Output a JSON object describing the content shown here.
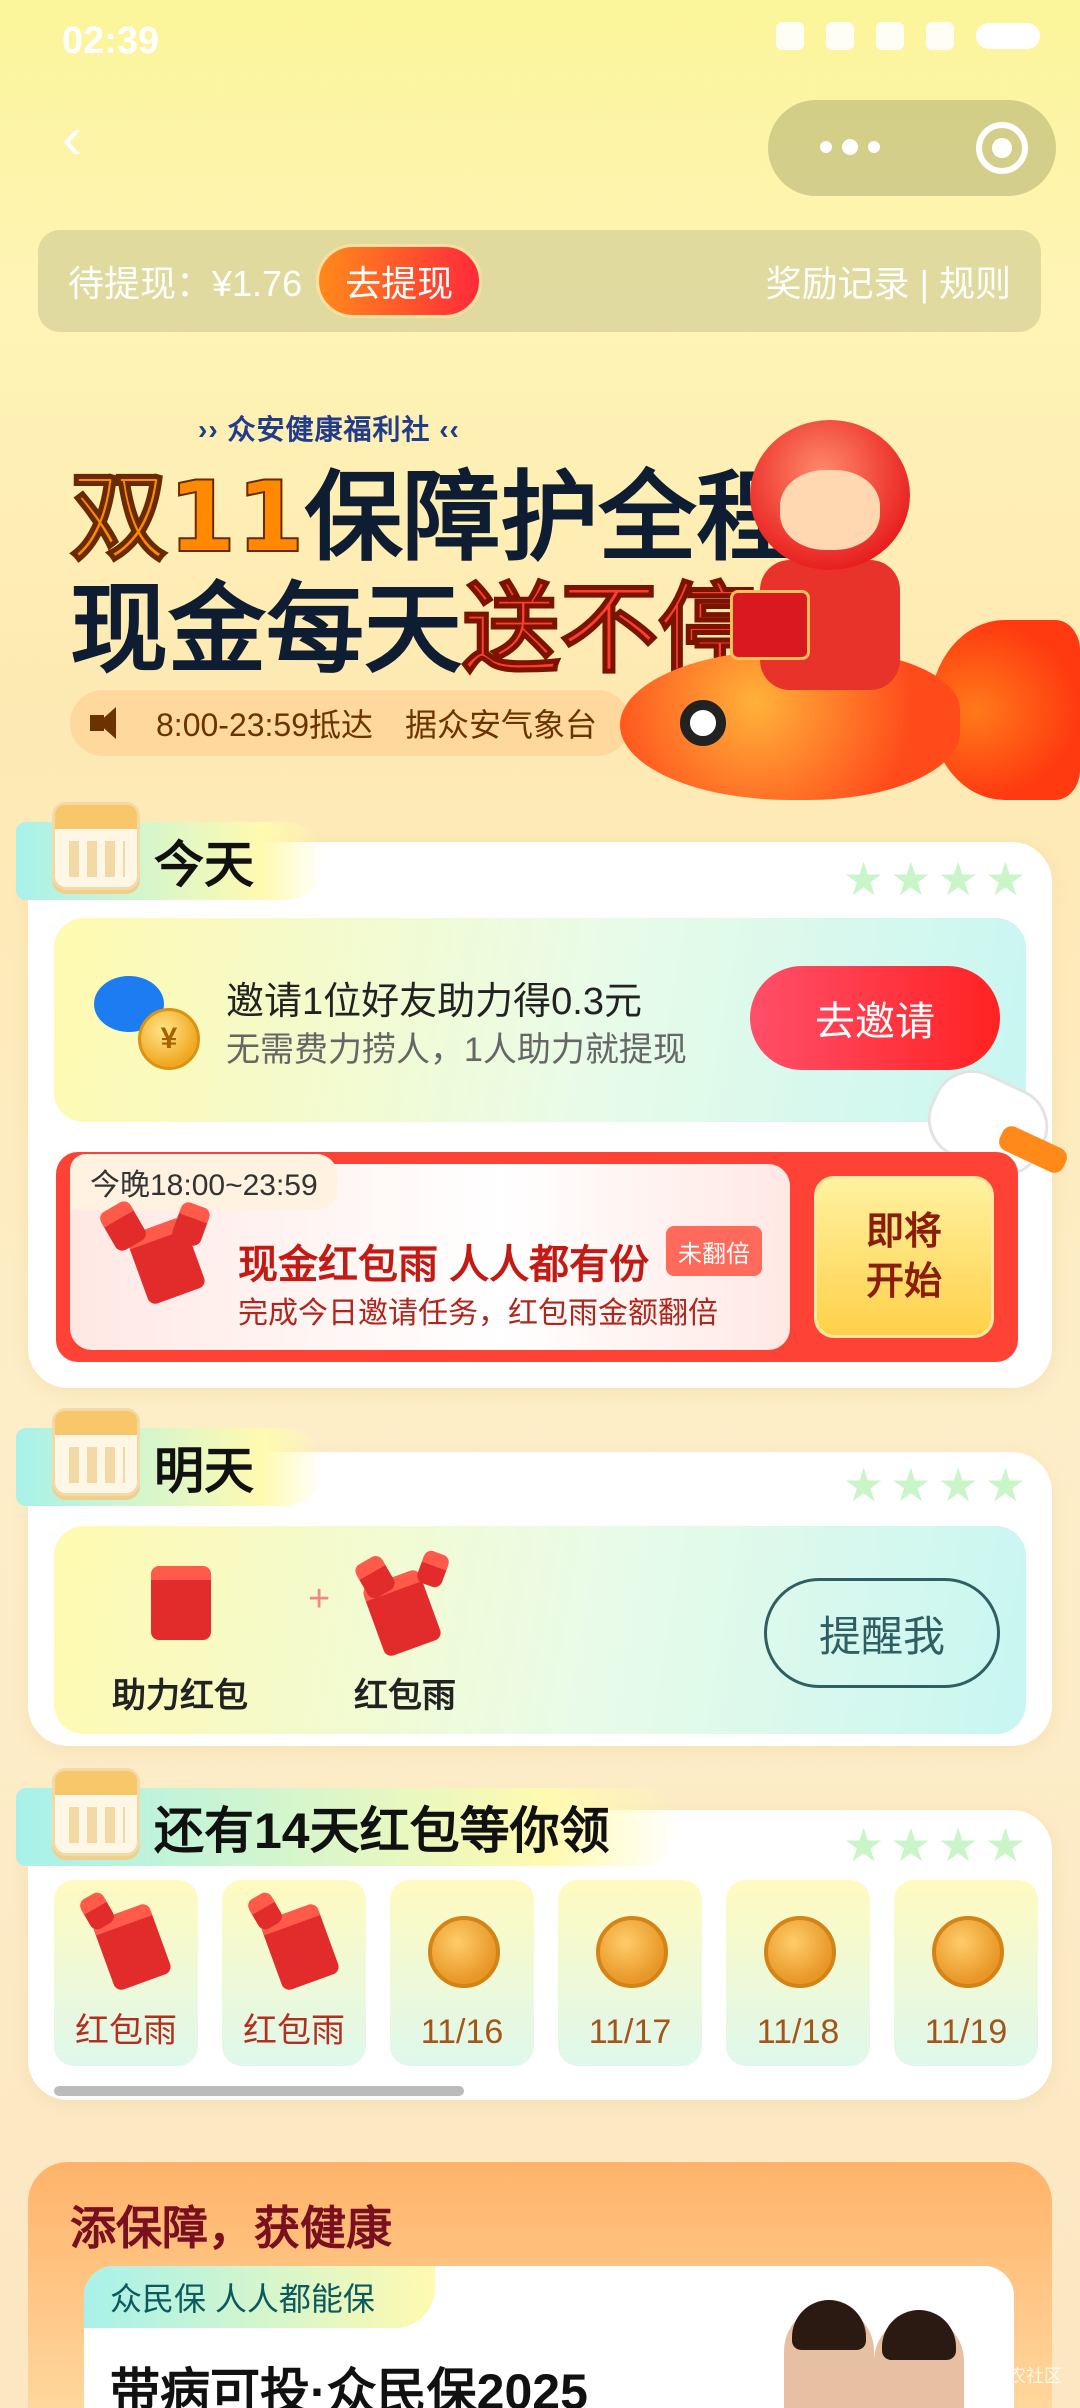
{
  "status_bar": {
    "time": "02:39"
  },
  "withdraw": {
    "label": "待提现：¥1.76",
    "button": "去提现",
    "links": "奖励记录 | 规则"
  },
  "banner": {
    "brand": "众安健康福利社",
    "line1_a": "双11",
    "line1_b": "保障护全程",
    "line2_a": "现金每天",
    "line2_b": "送不停",
    "ticker": "8:00-23:59抵达　据众安气象台"
  },
  "today": {
    "tag": "今天",
    "invite": {
      "title": "邀请1位好友助力得0.3元",
      "subtitle": "无需费力捞人，1人助力就提现",
      "button": "去邀请",
      "coin_label": "¥"
    },
    "rain": {
      "time": "今晚18:00~23:59",
      "title": "现金红包雨 人人都有份",
      "badge": "未翻倍",
      "subtitle": "完成今日邀请任务，红包雨金额翻倍",
      "button_line1": "即将",
      "button_line2": "开始"
    }
  },
  "tomorrow": {
    "tag": "明天",
    "items": [
      "助力红包",
      "红包雨"
    ],
    "plus": "+",
    "button": "提醒我"
  },
  "future": {
    "tag": "还有14天红包等你领",
    "days": [
      {
        "label": "红包雨",
        "kind": "envelope"
      },
      {
        "label": "红包雨",
        "kind": "envelope"
      },
      {
        "label": "11/16",
        "kind": "coin"
      },
      {
        "label": "11/17",
        "kind": "coin"
      },
      {
        "label": "11/18",
        "kind": "coin"
      },
      {
        "label": "11/19",
        "kind": "coin"
      }
    ]
  },
  "promo": {
    "title": "添保障，获健康",
    "tag": "众民保 人人都能保",
    "headline": "带病可投·众民保2025"
  },
  "watermark": "农社区",
  "colors": {
    "accent_red": "#ff2a2a",
    "accent_orange": "#ff8a1a",
    "mint": "#a8f1ea",
    "lemon": "#fffab0"
  }
}
